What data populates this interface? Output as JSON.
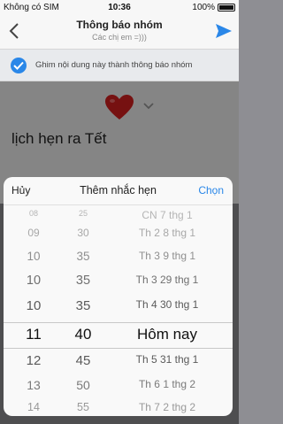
{
  "status": {
    "carrier": "Không có SIM",
    "time": "10:36",
    "battery": "100%"
  },
  "header": {
    "title": "Thông báo nhóm",
    "subtitle": "Các chị em =)))",
    "back_icon": "chevron-left-icon",
    "send_icon": "send-icon"
  },
  "pin": {
    "label": "Ghim nội dung này thành thông báo nhóm",
    "checked": true
  },
  "content": {
    "emoji": "heart",
    "message": "lịch hẹn ra Tết"
  },
  "sheet": {
    "cancel": "Hủy",
    "title": "Thêm nhắc hẹn",
    "choose": "Chọn",
    "hours": [
      "08",
      "09",
      "10",
      "10",
      "10",
      "11",
      "12",
      "13",
      "14"
    ],
    "minutes": [
      "25",
      "30",
      "35",
      "35",
      "35",
      "40",
      "45",
      "50",
      "55"
    ],
    "dates": [
      "CN 7 thg 1",
      "Th 2 8 thg 1",
      "Th 3 9 thg 1",
      "Th 3 29 thg 1",
      "Th 4 30 thg 1",
      "Hôm nay",
      "Th 5 31 thg 1",
      "Th 6 1 thg 2",
      "Th 7 2 thg 2"
    ],
    "accent": "#2a87e8"
  }
}
